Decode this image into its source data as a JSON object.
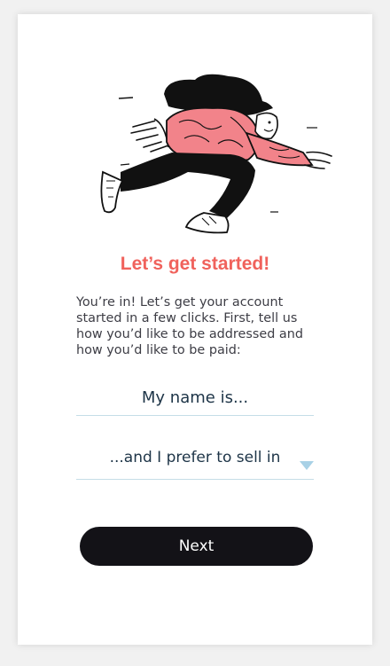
{
  "onboarding": {
    "title": "Let’s get started!",
    "intro": "You’re in! Let’s get your account started in a few clicks. First, tell us how you’d like to be addressed and how you’d like to be paid:",
    "name_placeholder": "My name is...",
    "name_value": "",
    "currency_label": "...and I prefer to sell in",
    "next_label": "Next"
  },
  "colors": {
    "title": "#f0625c",
    "button": "#131217",
    "underline": "#c5dde7",
    "chevron": "#a8d1e6",
    "illustration_accent": "#f2838a"
  },
  "icons": {
    "illustration": "running-person-illustration",
    "dropdown": "chevron-down-icon"
  }
}
